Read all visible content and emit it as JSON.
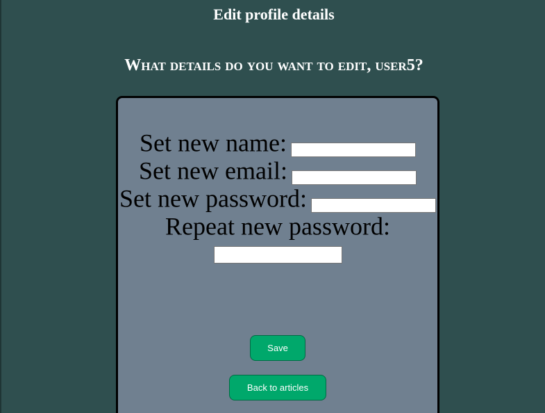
{
  "header": {
    "title": "Edit profile details",
    "prompt": "What details do you want to edit, user5?"
  },
  "form": {
    "name_label": "Set new name:",
    "name_value": "",
    "email_label": "Set new email:",
    "email_value": "",
    "password_label": "Set new password:",
    "password_value": "",
    "repeat_password_label": "Repeat new password:",
    "repeat_password_value": "",
    "save_label": "Save",
    "back_label": "Back to articles"
  },
  "colors": {
    "background": "#2f4f4f",
    "card": "#708090",
    "button": "#00a86b"
  }
}
